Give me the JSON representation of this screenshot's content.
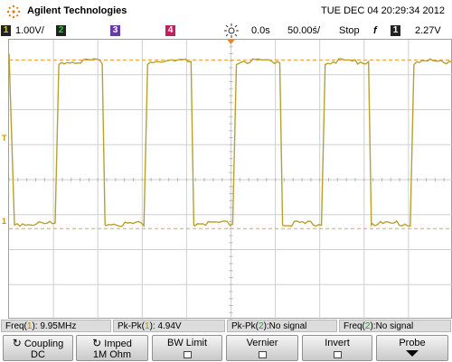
{
  "header": {
    "brand": "Agilent Technologies",
    "datetime": "TUE DEC 04 20:29:34 2012"
  },
  "status": {
    "ch1_label": "1",
    "ch1_scale": "1.00V/",
    "ch2_label": "2",
    "ch3_label": "3",
    "ch4_label": "4",
    "time_delay": "0.0s",
    "time_scale": "50.00ś/",
    "run_state": "Stop",
    "trigger_edge": "f",
    "trigger_ch": "1",
    "trigger_level": "2.27V"
  },
  "waveform": {
    "low_level_fraction": 0.63,
    "high_level_fraction": 0.05,
    "cycles": 5,
    "color": "#b8a030",
    "cursor_color": "#f0a040"
  },
  "measurements": {
    "m1_label": "Freq(",
    "m1_ch": "1",
    "m1_value": "): 9.95MHz",
    "m2_label": "Pk-Pk(",
    "m2_ch": "1",
    "m2_value": "): 4.94V",
    "m3_label": "Pk-Pk(",
    "m3_ch": "2",
    "m3_value": "):No signal",
    "m4_label": "Freq(",
    "m4_ch": "2",
    "m4_value": "):No signal"
  },
  "softkeys": {
    "coupling_top": "Coupling",
    "coupling_bottom": "DC",
    "imped_top": "Imped",
    "imped_bottom": "1M Ohm",
    "bwlimit": "BW Limit",
    "vernier": "Vernier",
    "invert": "Invert",
    "probe": "Probe"
  },
  "colors": {
    "ch1": "#f0d000",
    "ch2": "#30d030",
    "ch3": "#6a3aa8",
    "ch4": "#c02060",
    "trace": "#b8a030"
  }
}
